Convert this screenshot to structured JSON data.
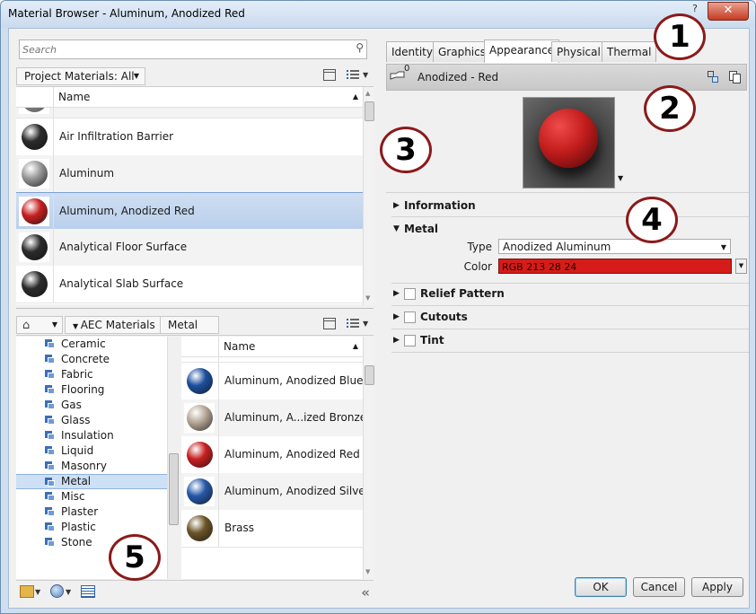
{
  "window": {
    "title": "Material Browser - Aluminum, Anodized Red",
    "help_label": "?",
    "close_label": "✕"
  },
  "left": {
    "search_placeholder": "Search",
    "project_dropdown": "Project Materials: All",
    "column_name": "Name",
    "project_materials": [
      {
        "name": "Air Infiltration Barrier",
        "swatch": "#2b2b2b"
      },
      {
        "name": "Aluminum",
        "swatch": "#9a9a9a"
      },
      {
        "name": "Aluminum, Anodized Red",
        "swatch": "#c82020",
        "selected": true
      },
      {
        "name": "Analytical Floor Surface",
        "swatch": "#2b2b2b"
      },
      {
        "name": "Analytical Slab Surface",
        "swatch": "#2b2b2b"
      }
    ],
    "library": {
      "breadcrumb": [
        "AEC Materials",
        "Metal"
      ],
      "categories": [
        "Ceramic",
        "Concrete",
        "Fabric",
        "Flooring",
        "Gas",
        "Glass",
        "Insulation",
        "Liquid",
        "Masonry",
        "Metal",
        "Misc",
        "Plaster",
        "Plastic",
        "Stone"
      ],
      "selected_category": "Metal",
      "column_name": "Name",
      "items": [
        {
          "name": "Aluminum, Anodized Blue",
          "swatch": "#1d4f9e"
        },
        {
          "name": "Aluminum, A...ized Bronze",
          "swatch": "#b8a898"
        },
        {
          "name": "Aluminum, Anodized Red",
          "swatch": "#c82020"
        },
        {
          "name": "Aluminum, Anodized Silver",
          "swatch": "#2457a8"
        },
        {
          "name": "Brass",
          "swatch": "#6b5528"
        }
      ]
    },
    "collapse_label": "«"
  },
  "right": {
    "tabs": [
      "Identity",
      "Graphics",
      "Appearance",
      "Physical",
      "Thermal"
    ],
    "active_tab": "Appearance",
    "asset_count": "0",
    "asset_name": "Anodized - Red",
    "sections": {
      "information": "Information",
      "metal": "Metal",
      "relief": "Relief Pattern",
      "cutouts": "Cutouts",
      "tint": "Tint"
    },
    "metal": {
      "type_label": "Type",
      "type_value": "Anodized Aluminum",
      "color_label": "Color",
      "color_value": "RGB 213 28 24",
      "color_hex": "#d51c18"
    }
  },
  "buttons": {
    "ok": "OK",
    "cancel": "Cancel",
    "apply": "Apply"
  },
  "callouts": [
    "1",
    "2",
    "3",
    "4",
    "5"
  ]
}
